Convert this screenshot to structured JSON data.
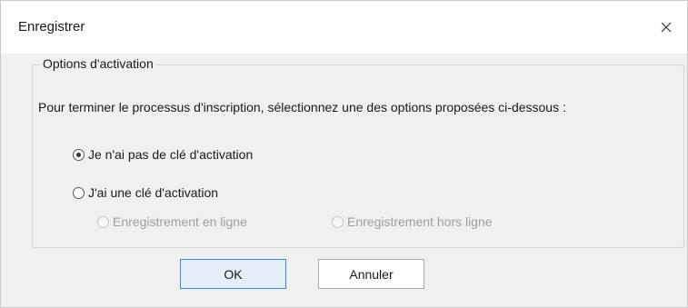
{
  "dialog": {
    "title": "Enregistrer",
    "close_glyph": "×"
  },
  "group": {
    "legend": "Options d'activation",
    "instruction": "Pour terminer le processus d'inscription, sélectionnez une des options proposées ci-dessous :",
    "options": [
      {
        "label": "Je n'ai pas de clé d'activation",
        "selected": true,
        "enabled": true
      },
      {
        "label": "J'ai une clé d'activation",
        "selected": false,
        "enabled": true
      }
    ],
    "sub_options": [
      {
        "label": "Enregistrement en ligne",
        "selected": false,
        "enabled": false
      },
      {
        "label": "Enregistrement hors ligne",
        "selected": false,
        "enabled": false
      }
    ]
  },
  "buttons": {
    "ok_label": "OK",
    "cancel_label": "Annuler"
  },
  "colors": {
    "accent": "#3a8ad6",
    "dialog_background": "#f0f0f0",
    "disabled_text": "#9e9e9e"
  }
}
